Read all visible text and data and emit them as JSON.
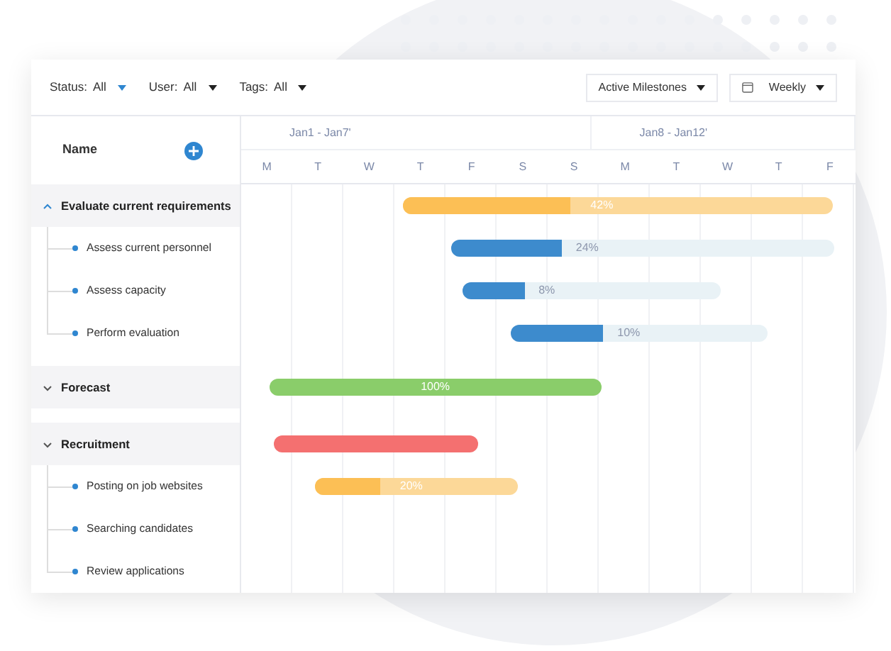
{
  "toolbar": {
    "filters": [
      {
        "label": "Status:",
        "value": "All",
        "highlighted": true
      },
      {
        "label": "User:",
        "value": "All",
        "highlighted": false
      },
      {
        "label": "Tags:",
        "value": "All",
        "highlighted": false
      }
    ],
    "milestones_dropdown": "Active Milestones",
    "view_dropdown": "Weekly"
  },
  "name_header": "Name",
  "weeks": [
    {
      "label": "Jan1 - Jan7'",
      "days": [
        "M",
        "T",
        "W",
        "T",
        "F",
        "S",
        "S"
      ]
    },
    {
      "label": "Jan8 - Jan12'",
      "days": [
        "M",
        "T",
        "W",
        "T",
        "F"
      ]
    }
  ],
  "groups": [
    {
      "name": "Evaluate current requirements",
      "expanded": true,
      "bar": {
        "kind": "milestone",
        "color": "#fcbf55",
        "level": 0.39,
        "reading": "42%"
      },
      "children": [
        {
          "name": "Assess current personnel",
          "bar": {
            "kind": "task",
            "color": "#3d8bcd",
            "level": 0.29,
            "reading": "24%"
          }
        },
        {
          "name": "Assess capacity",
          "bar": {
            "kind": "task",
            "color": "#3d8bcd",
            "level": 0.24,
            "reading": "8%"
          }
        },
        {
          "name": "Perform evaluation",
          "bar": {
            "kind": "task",
            "color": "#3d8bcd",
            "level": 0.36,
            "reading": "10%"
          }
        }
      ]
    },
    {
      "name": "Forecast",
      "expanded": false,
      "bar": {
        "kind": "phase",
        "color": "#8acd6a",
        "level": 1,
        "reading": "100%"
      }
    },
    {
      "name": "Recruitment",
      "expanded": false,
      "bar": {
        "kind": "phase",
        "color": "#f47070",
        "level": 1
      },
      "children": [
        {
          "name": "Posting on job websites",
          "bar": {
            "kind": "milestone",
            "color": "#fcbf55",
            "level": 0.32,
            "reading": "20%"
          }
        },
        {
          "name": "Searching candidates"
        },
        {
          "name": "Review applications"
        }
      ]
    }
  ]
}
